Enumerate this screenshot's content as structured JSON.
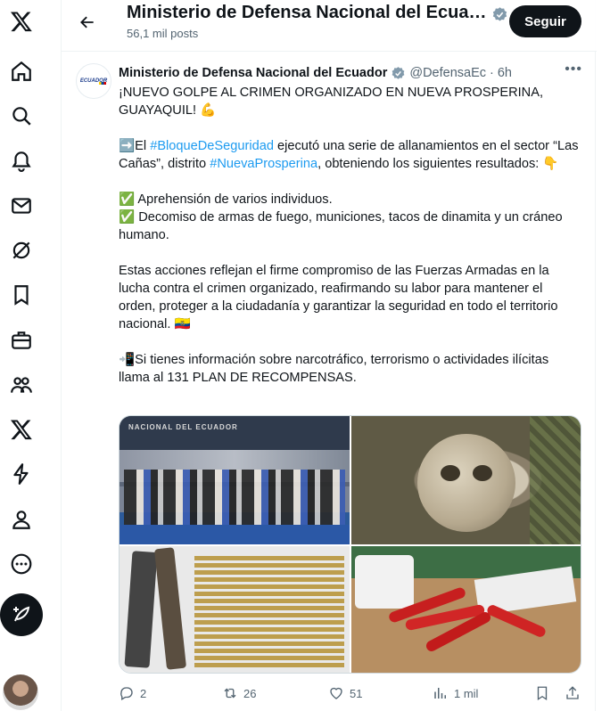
{
  "nav": {
    "items": [
      "x-logo-icon",
      "home-icon",
      "explore-icon",
      "notifications-icon",
      "messages-icon",
      "grok-icon",
      "bookmarks-icon",
      "jobs-icon",
      "communities-icon",
      "premium-icon",
      "verified-orgs-icon",
      "profile-icon",
      "more-icon"
    ]
  },
  "header": {
    "title": "Ministerio de Defensa Nacional del Ecuador",
    "post_count": "56,1 mil posts",
    "follow_label": "Seguir"
  },
  "tweet": {
    "avatar_text": "ECUADOR",
    "name": "Ministerio de Defensa Nacional del Ecuador",
    "handle": "@DefensaEc",
    "sep": "·",
    "time": "6h",
    "line1": "¡NUEVO GOLPE AL CRIMEN ORGANIZADO EN NUEVA PROSPERINA, GUAYAQUIL! 💪",
    "p2_a": "➡️El ",
    "p2_tag1": "#BloqueDeSeguridad",
    "p2_b": " ejecutó una serie de allanamientos en el sector “Las Cañas”, distrito ",
    "p2_tag2": "#NuevaProsperina",
    "p2_c": ", obteniendo los siguientes resultados: 👇",
    "bullet1": "✅ Aprehensión de varios individuos.",
    "bullet2": "✅ Decomiso de armas de fuego, municiones, tacos de dinamita y un cráneo humano.",
    "p4": "Estas acciones reflejan el firme compromiso de las Fuerzas Armadas en la lucha contra el crimen organizado, reafirmando su labor para mantener el orden, proteger a la ciudadanía y garantizar la seguridad en todo el territorio nacional. 🇪🇨",
    "p5": "📲Si tienes información sobre narcotráfico, terrorismo o actividades ilícitas llama al 131 PLAN DE RECOMPENSAS.",
    "photo1_text": "NACIONAL DEL ECUADOR",
    "replies": "2",
    "reposts": "26",
    "likes": "51",
    "views": "1 mil"
  }
}
